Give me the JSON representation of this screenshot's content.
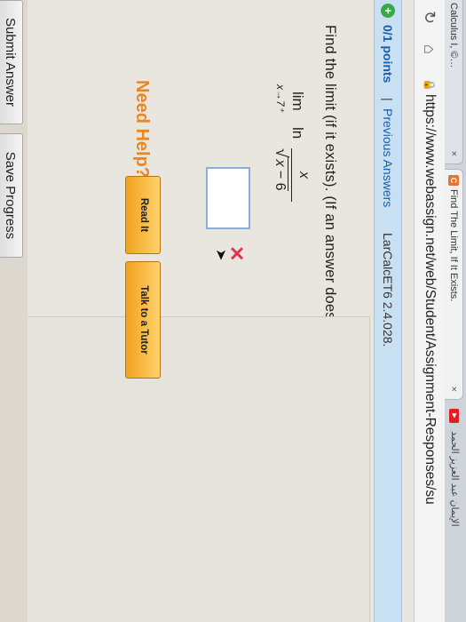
{
  "browser": {
    "tab1_title": "Calculus I, ©…",
    "tab1_close": "×",
    "tab2_title": "Find The Limit, If It Exists.",
    "tab2_close": "×",
    "tab2_fav": "C",
    "right_tab_text": "الإيمان عبد العزيز الحمد",
    "url": "https://www.webassign.net/web/Student/Assignment-Responses/su"
  },
  "question": {
    "points": "0/1 points",
    "separator": "|",
    "previous_answers": "Previous Answers",
    "code": "LarCalcET6 2.4.028.",
    "prompt": "Find the limit (if it exists). (If an answer does not exist, enter DNE.)"
  },
  "math": {
    "lim": "lim",
    "sub": "x→7⁺",
    "ln": "ln",
    "numerator": "x",
    "radical": "√",
    "den_var": "x",
    "den_rest": " − 6"
  },
  "answer": {
    "value": "",
    "status_mark": "✕"
  },
  "help": {
    "label": "Need Help?",
    "read_it": "Read It",
    "talk_tutor": "Talk to a Tutor"
  },
  "footer": {
    "submit": "Submit Answer",
    "save": "Save Progress"
  },
  "colors": {
    "header_bg": "#c9dff2",
    "link": "#1a5fa8",
    "need_help": "#e98720",
    "wrong_mark": "#e0344a",
    "correct_plus": "#3aa84a"
  }
}
